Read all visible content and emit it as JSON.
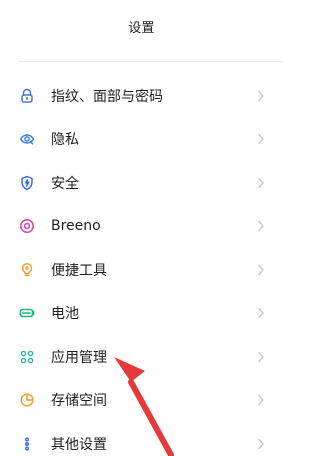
{
  "header": {
    "title": "设置"
  },
  "settings": {
    "items": [
      {
        "label": "指纹、面部与密码",
        "icon": "lock-icon",
        "color": "#4a78c9"
      },
      {
        "label": "隐私",
        "icon": "privacy-icon",
        "color": "#3b7fe2"
      },
      {
        "label": "安全",
        "icon": "shield-icon",
        "color": "#3569d8"
      },
      {
        "label": "Breeno",
        "icon": "breeno-icon",
        "color": "#d34bb1"
      },
      {
        "label": "便捷工具",
        "icon": "tool-bulb-icon",
        "color": "#f2a12f"
      },
      {
        "label": "电池",
        "icon": "battery-icon",
        "color": "#22b57a"
      },
      {
        "label": "应用管理",
        "icon": "apps-grid-icon",
        "color": "#2ab3a3"
      },
      {
        "label": "存储空间",
        "icon": "storage-pie-icon",
        "color": "#f39b2f"
      },
      {
        "label": "其他设置",
        "icon": "more-dots-icon",
        "color": "#3d6fe0"
      }
    ]
  },
  "annotation": {
    "arrow_color": "#e63a3a"
  }
}
